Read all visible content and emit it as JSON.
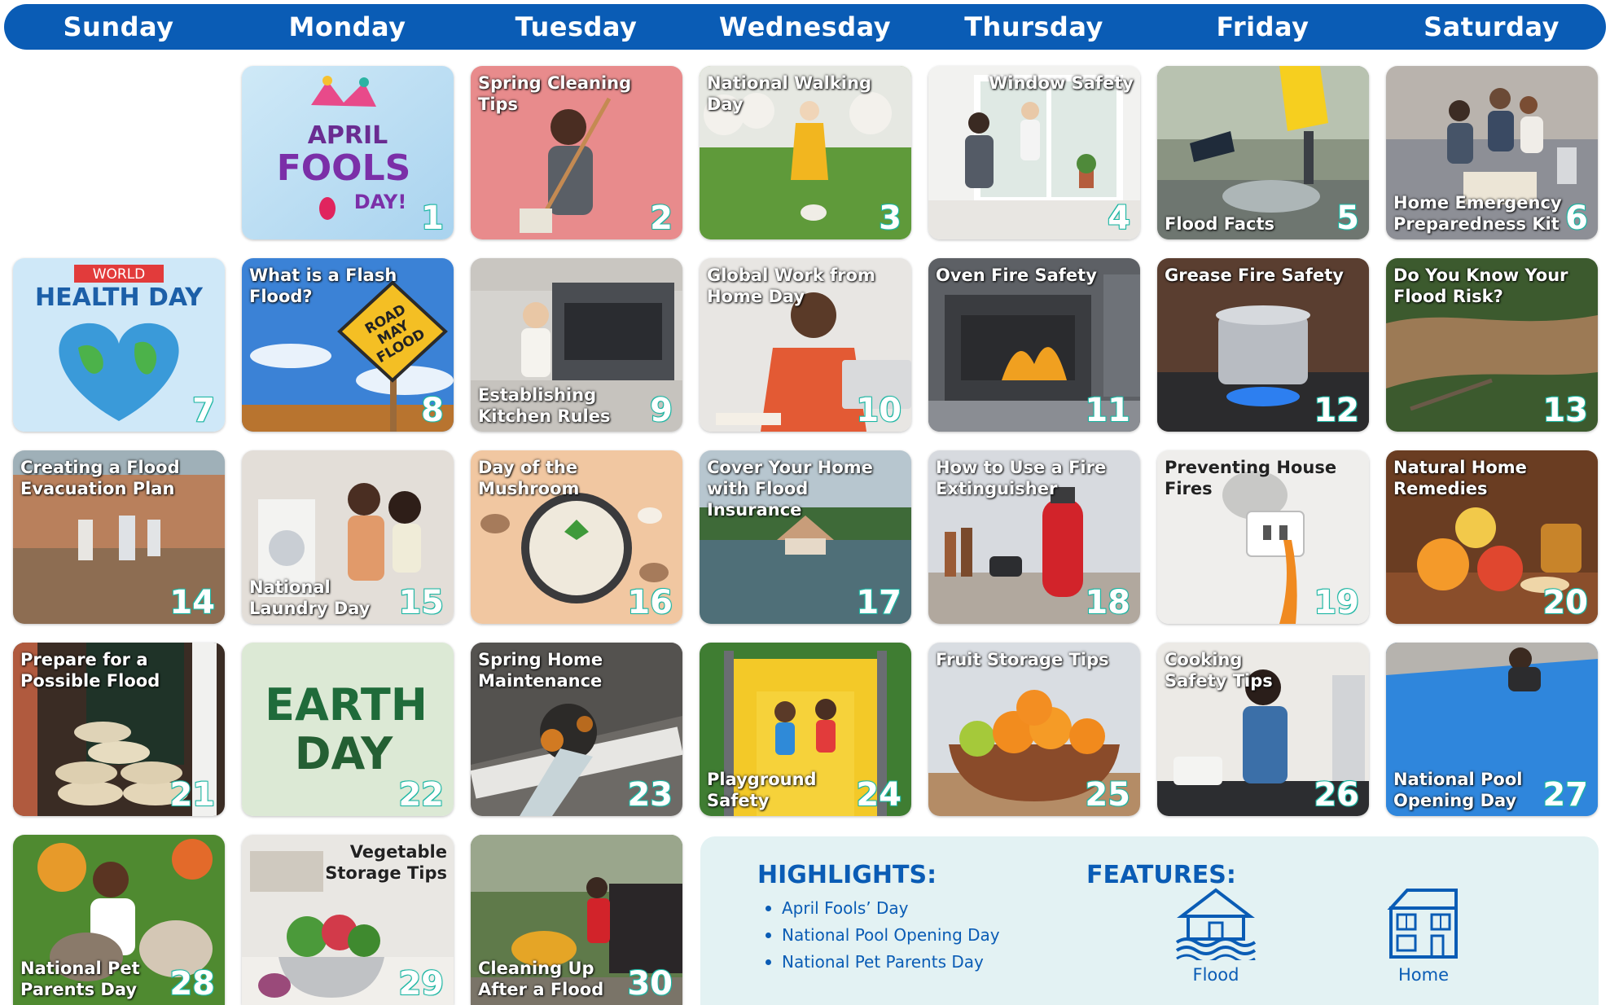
{
  "calendar": {
    "weekdays": [
      "Sunday",
      "Monday",
      "Tuesday",
      "Wednesday",
      "Thursday",
      "Friday",
      "Saturday"
    ],
    "days": [
      {
        "number": "1",
        "title": "",
        "art_text": {
          "line1": "APRIL",
          "line2": "FOOLS",
          "line3": "DAY!"
        }
      },
      {
        "number": "2",
        "title": "Spring Cleaning Tips"
      },
      {
        "number": "3",
        "title": "National Walking Day"
      },
      {
        "number": "4",
        "title": "Window Safety"
      },
      {
        "number": "5",
        "title": "Flood Facts"
      },
      {
        "number": "6",
        "title": "Home Emergency\nPreparedness Kit"
      },
      {
        "number": "7",
        "title": "",
        "art_text": {
          "line1": "WORLD",
          "line2": "HEALTH DAY"
        }
      },
      {
        "number": "8",
        "title": "What is a Flash\nFlood?",
        "art_text": {
          "sign": "ROAD\nMAY\nFLOOD"
        }
      },
      {
        "number": "9",
        "title": "Establishing\nKitchen Rules"
      },
      {
        "number": "10",
        "title": "Global Work from\nHome Day"
      },
      {
        "number": "11",
        "title": "Oven Fire Safety"
      },
      {
        "number": "12",
        "title": "Grease Fire Safety"
      },
      {
        "number": "13",
        "title": "Do You Know Your\nFlood Risk?"
      },
      {
        "number": "14",
        "title": "Creating a Flood\nEvacuation Plan"
      },
      {
        "number": "15",
        "title": "National\nLaundry Day"
      },
      {
        "number": "16",
        "title": "Day of the Mushroom"
      },
      {
        "number": "17",
        "title": "Cover Your Home\nwith Flood Insurance"
      },
      {
        "number": "18",
        "title": "How to Use a Fire\nExtinguisher"
      },
      {
        "number": "19",
        "title": "Preventing House\nFires"
      },
      {
        "number": "20",
        "title": "Natural Home\nRemedies"
      },
      {
        "number": "21",
        "title": "Prepare for a\nPossible Flood"
      },
      {
        "number": "22",
        "title": "",
        "art_text": {
          "line1": "EARTH",
          "line2": "DAY"
        }
      },
      {
        "number": "23",
        "title": "Spring Home\nMaintenance"
      },
      {
        "number": "24",
        "title": "Playground\nSafety"
      },
      {
        "number": "25",
        "title": "Fruit Storage Tips"
      },
      {
        "number": "26",
        "title": "Cooking\nSafety Tips"
      },
      {
        "number": "27",
        "title": "National Pool\nOpening Day"
      },
      {
        "number": "28",
        "title": "National Pet\nParents Day"
      },
      {
        "number": "29",
        "title": "Vegetable\nStorage Tips"
      },
      {
        "number": "30",
        "title": "Cleaning Up\nAfter a Flood"
      }
    ]
  },
  "info": {
    "highlights_heading": "HIGHLIGHTS:",
    "highlights": [
      "April Fools’ Day",
      "National Pool Opening Day",
      "National Pet Parents Day"
    ],
    "features_heading": "FEATURES:",
    "features": [
      {
        "label": "Flood",
        "icon": "flooded-house-icon"
      },
      {
        "label": "Home",
        "icon": "house-icon"
      }
    ]
  },
  "colors": {
    "header_bg": "#0a5cb5",
    "accent_teal": "#1db6a3",
    "info_bg": "#e3f2f3",
    "text_blue": "#0a5cb5"
  }
}
